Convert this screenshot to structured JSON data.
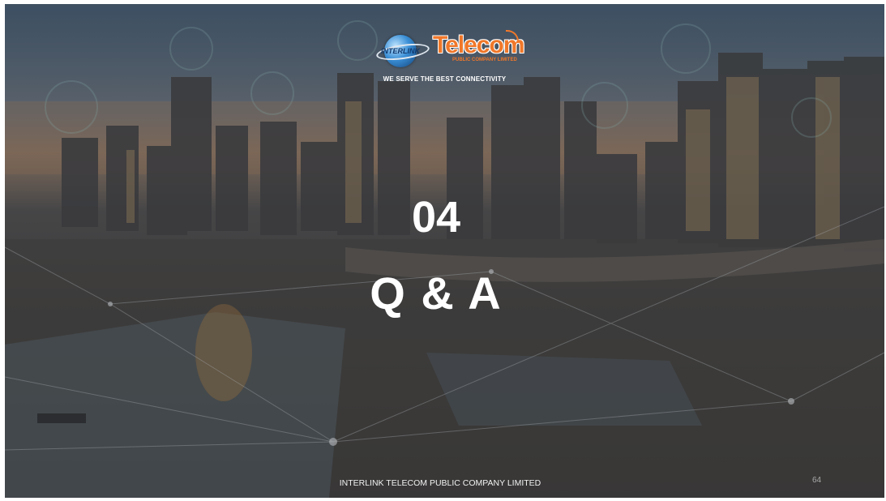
{
  "logo": {
    "brand_prefix": "INTERLINK",
    "brand_name": "Telecom",
    "brand_sub": "PUBLIC COMPANY LIMITED"
  },
  "tagline": "WE SERVE THE BEST CONNECTIVITY",
  "section_number": "04",
  "section_title": "Q & A",
  "footer": "INTERLINK TELECOM PUBLIC COMPANY LIMITED",
  "page_number": "64",
  "colors": {
    "brand_orange": "#f0782a",
    "brand_blue": "#11427a",
    "text_white": "#ffffff"
  }
}
